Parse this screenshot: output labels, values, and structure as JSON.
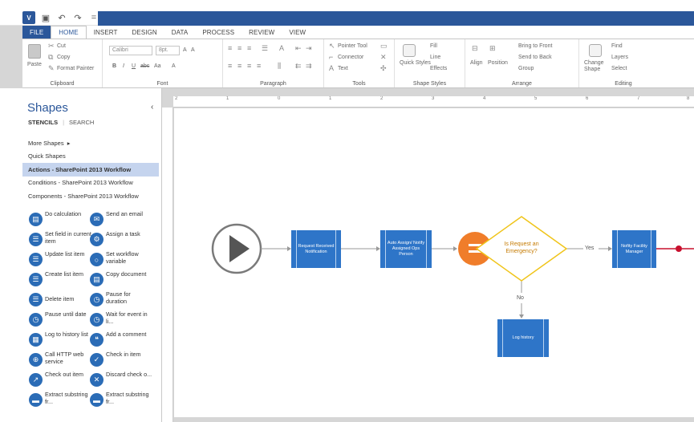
{
  "quick_access": {
    "logo": "V"
  },
  "tabs": [
    "FILE",
    "HOME",
    "INSERT",
    "DESIGN",
    "DATA",
    "PROCESS",
    "REVIEW",
    "VIEW"
  ],
  "ribbon": {
    "clipboard": {
      "paste": "Paste",
      "cut": "Cut",
      "copy": "Copy",
      "format_painter": "Format Painter",
      "label": "Clipboard"
    },
    "font": {
      "name": "Calibri",
      "size": "8pt.",
      "bold": "B",
      "italic": "I",
      "underline": "U",
      "strike": "abc",
      "case": "Aa",
      "color": "A",
      "grow": "A",
      "shrink": "A",
      "label": "Font"
    },
    "paragraph": {
      "label": "Paragraph"
    },
    "tools": {
      "pointer": "Pointer Tool",
      "connector": "Connector",
      "text": "Text",
      "label": "Tools"
    },
    "shape_styles": {
      "quick_styles": "Quick Styles",
      "fill": "Fill",
      "line": "Line",
      "effects": "Effects",
      "label": "Shape Styles"
    },
    "arrange": {
      "align": "Align",
      "position": "Position",
      "bring_front": "Bring to Front",
      "send_back": "Send to Back",
      "group": "Group",
      "label": "Arrange"
    },
    "editing": {
      "change_shape": "Change Shape",
      "find": "Find",
      "layers": "Layers",
      "select": "Select",
      "label": "Editing"
    }
  },
  "shapes_panel": {
    "title": "Shapes",
    "tab_stencils": "STENCILS",
    "tab_search": "SEARCH",
    "more_shapes": "More Shapes",
    "stencils": [
      "Quick Shapes",
      "Actions - SharePoint 2013 Workflow",
      "Conditions - SharePoint 2013 Workflow",
      "Components - SharePoint 2013 Workflow"
    ],
    "items": [
      "Do calculation",
      "Send an email",
      "Set field in current item",
      "Assign a task",
      "Update list item",
      "Set workflow variable",
      "Create list item",
      "Copy document",
      "Delete item",
      "Pause for duration",
      "Pause until date",
      "Wait for event in li...",
      "Log to history list",
      "Add a comment",
      "Call HTTP web service",
      "Check in item",
      "Check out item",
      "Discard check o...",
      "Extract substring fr...",
      "Extract substring fr..."
    ]
  },
  "ruler": [
    "2",
    "1",
    "0",
    "1",
    "2",
    "3",
    "4",
    "5",
    "6",
    "7",
    "8"
  ],
  "diagram": {
    "node1": "Request Received Notification",
    "node2": "Auto Assign/ Notify Assigned Ops Person",
    "decision": "Is Request an Emergency?",
    "yes": "Yes",
    "no": "No",
    "node3": "Nofity Facility Manager",
    "node4": "Log history"
  },
  "colors": {
    "brand": "#2b579a",
    "process": "#2e75c8",
    "decision": "#f0c419",
    "gateway": "#f07d2a",
    "end": "#c8102e"
  }
}
